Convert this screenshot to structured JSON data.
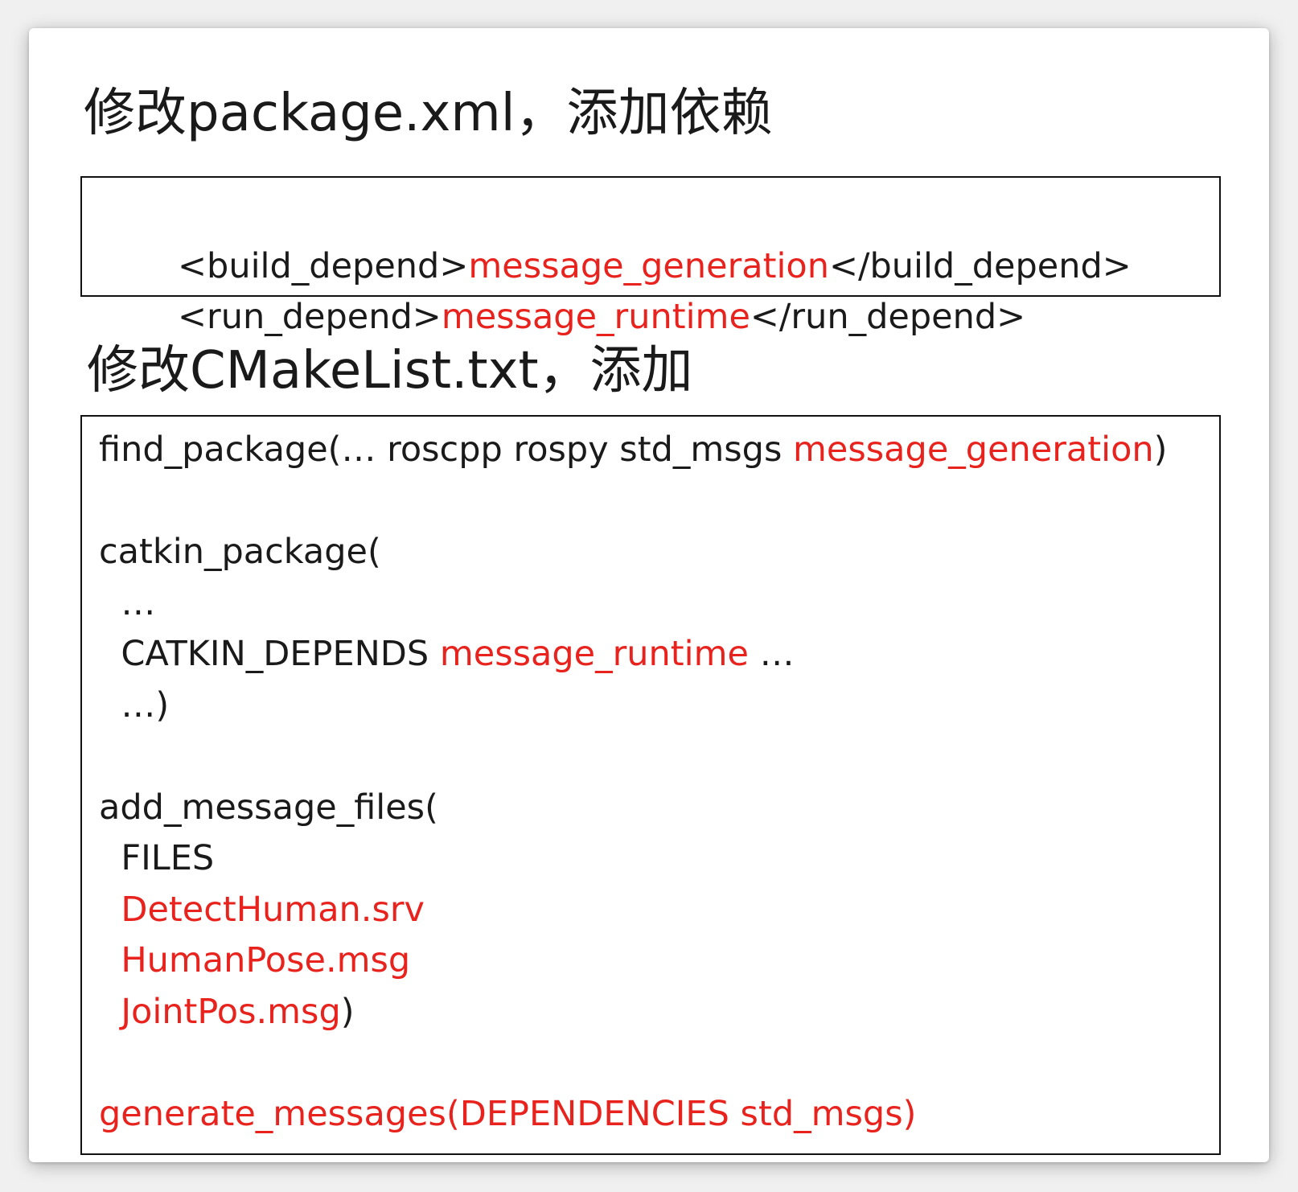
{
  "slide": {
    "heading_1": "修改package.xml，添加依赖",
    "xml_lines": [
      [
        {
          "t": "<build_depend>",
          "c": "black"
        },
        {
          "t": "message_generation",
          "c": "red"
        },
        {
          "t": "</build_depend>",
          "c": "black"
        }
      ],
      [
        {
          "t": "<run_depend>",
          "c": "black"
        },
        {
          "t": "message_runtime",
          "c": "red"
        },
        {
          "t": "</run_depend>",
          "c": "black"
        }
      ]
    ],
    "heading_2": "修改CMakeList.txt，添加",
    "cmake_lines": [
      [
        {
          "t": "find_package(… roscpp rospy std_msgs ",
          "c": "black"
        },
        {
          "t": "message_generation",
          "c": "red"
        },
        {
          "t": ")",
          "c": "black"
        }
      ],
      [],
      [
        {
          "t": "catkin_package(",
          "c": "black"
        }
      ],
      [
        {
          "t": "  …",
          "c": "black"
        }
      ],
      [
        {
          "t": "  CATKIN_DEPENDS ",
          "c": "black"
        },
        {
          "t": "message_runtime",
          "c": "red"
        },
        {
          "t": " …",
          "c": "black"
        }
      ],
      [
        {
          "t": "  …)",
          "c": "black"
        }
      ],
      [],
      [
        {
          "t": "add_message_files(",
          "c": "black"
        }
      ],
      [
        {
          "t": "  FILES",
          "c": "black"
        }
      ],
      [
        {
          "t": "  DetectHuman.srv",
          "c": "red"
        }
      ],
      [
        {
          "t": "  HumanPose.msg",
          "c": "red"
        }
      ],
      [
        {
          "t": "  JointPos.msg",
          "c": "red"
        },
        {
          "t": ")",
          "c": "black"
        }
      ],
      [],
      [
        {
          "t": "generate_messages(DEPENDENCIES std_msgs)",
          "c": "red"
        }
      ]
    ]
  },
  "colors": {
    "highlight": "#e8231e",
    "text": "#1a1a1a",
    "border": "#111111",
    "background": "#ffffff"
  }
}
